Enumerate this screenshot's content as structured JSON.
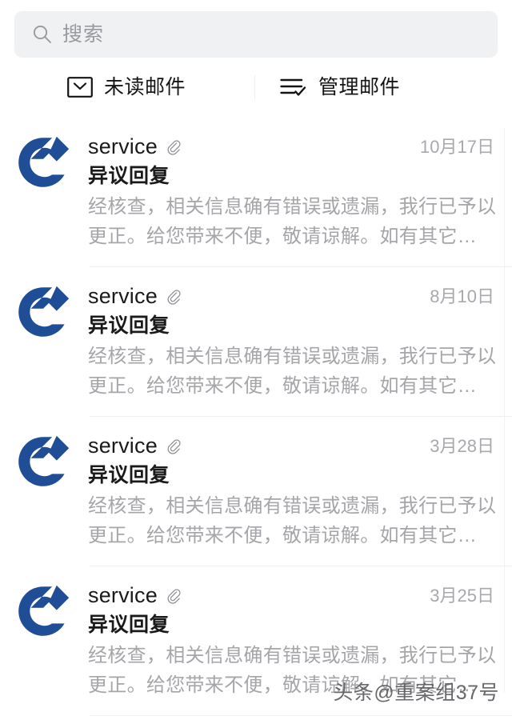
{
  "search": {
    "placeholder": "搜索",
    "icon": "search-icon"
  },
  "toolbar": {
    "unread": {
      "label": "未读邮件",
      "icon": "envelope-icon"
    },
    "manage": {
      "label": "管理邮件",
      "icon": "list-check-icon"
    }
  },
  "colors": {
    "brand_blue": "#1f4e96",
    "background": "#ffffff",
    "search_field": "#f0f1f3",
    "primary_text": "#1a1a1a",
    "secondary_text": "#a6a6aa",
    "divider": "#f0f0f0"
  },
  "mails": [
    {
      "avatar": "ccb-bank-logo",
      "sender": "service",
      "attachment_icon": "paperclip-icon",
      "date": "10月17日",
      "subject": "异议回复",
      "preview": "经核查，相关信息确有错误或遗漏，我行已予以更正。给您带来不便，敬请谅解。如有其它…"
    },
    {
      "avatar": "ccb-bank-logo",
      "sender": "service",
      "attachment_icon": "paperclip-icon",
      "date": "8月10日",
      "subject": "异议回复",
      "preview": "经核查，相关信息确有错误或遗漏，我行已予以更正。给您带来不便，敬请谅解。如有其它…"
    },
    {
      "avatar": "ccb-bank-logo",
      "sender": "service",
      "attachment_icon": "paperclip-icon",
      "date": "3月28日",
      "subject": "异议回复",
      "preview": "经核查，相关信息确有错误或遗漏，我行已予以更正。给您带来不便，敬请谅解。如有其它…"
    },
    {
      "avatar": "ccb-bank-logo",
      "sender": "service",
      "attachment_icon": "paperclip-icon",
      "date": "3月25日",
      "subject": "异议回复",
      "preview": "经核查，相关信息确有错误或遗漏，我行已予以更正。给您带来不便，敬请谅解。如有其它…"
    }
  ],
  "watermark": {
    "text": "头条@重案组37号"
  }
}
